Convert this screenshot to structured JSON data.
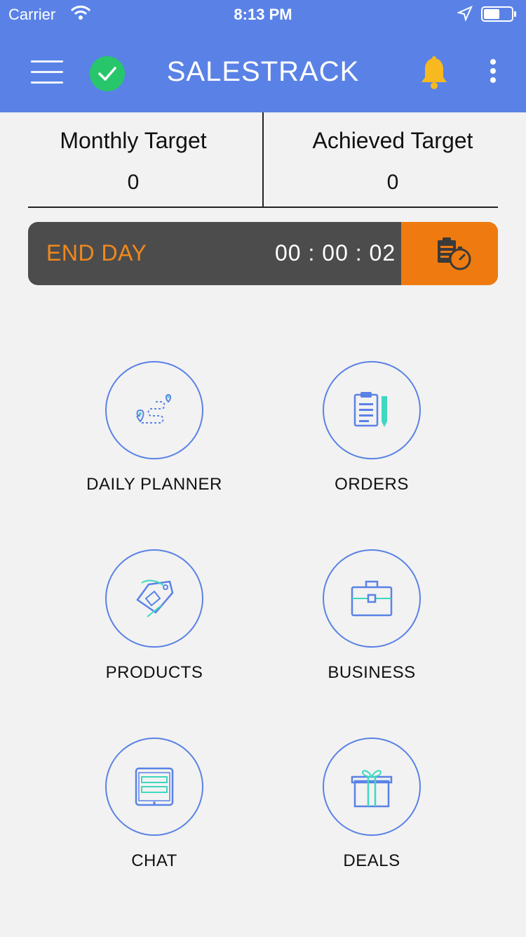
{
  "status_bar": {
    "carrier": "Carrier",
    "time": "8:13 PM"
  },
  "app_bar": {
    "title": "SALESTRACK"
  },
  "targets": {
    "monthly_label": "Monthly Target",
    "monthly_value": "0",
    "achieved_label": "Achieved Target",
    "achieved_value": "0"
  },
  "end_day": {
    "label": "END DAY",
    "timer": "00 : 00 : 02"
  },
  "tiles": [
    {
      "label": "DAILY PLANNER",
      "icon": "route-map-icon"
    },
    {
      "label": "ORDERS",
      "icon": "clipboard-pencil-icon"
    },
    {
      "label": "PRODUCTS",
      "icon": "price-tag-icon"
    },
    {
      "label": "BUSINESS",
      "icon": "briefcase-icon"
    },
    {
      "label": "CHAT",
      "icon": "chat-tablet-icon"
    },
    {
      "label": "DEALS",
      "icon": "gift-icon"
    }
  ],
  "colors": {
    "primary": "#5a82e6",
    "accent_orange": "#ef7b10",
    "success_green": "#28c66b",
    "bell_yellow": "#f7b820",
    "endday_bg": "#4c4c4c",
    "icon_teal": "#3ed8c0"
  }
}
